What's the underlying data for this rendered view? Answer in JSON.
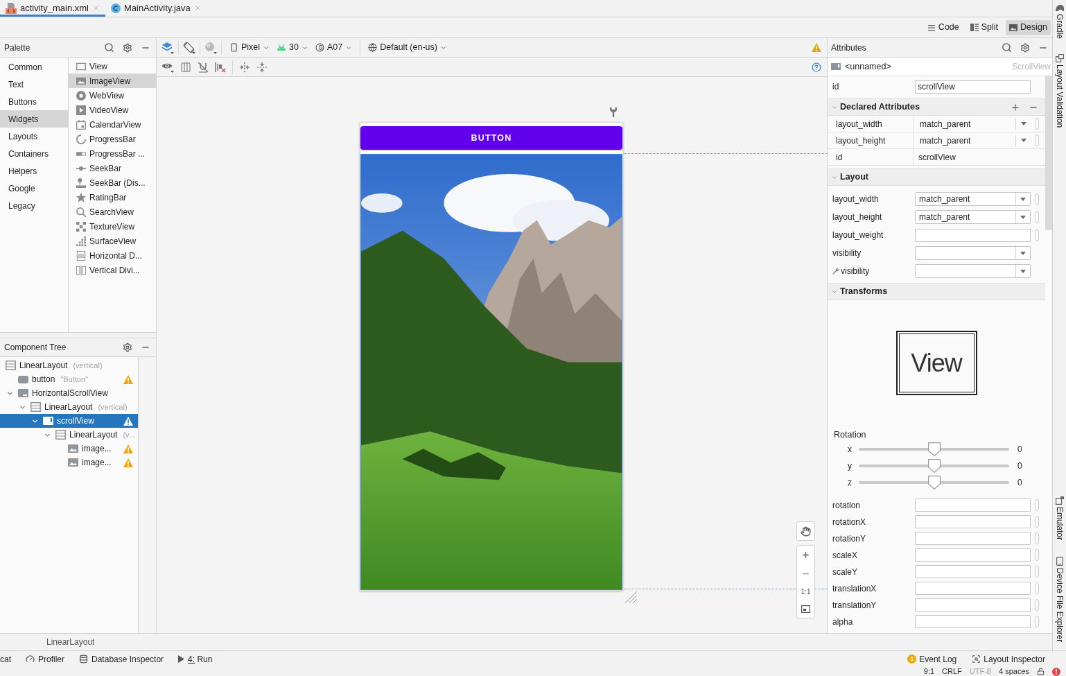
{
  "editor_tabs": [
    {
      "label": "activity_main.xml",
      "kind": "xml",
      "selected": true
    },
    {
      "label": "MainActivity.java",
      "kind": "java",
      "selected": false
    }
  ],
  "view_modes": [
    {
      "label": "Code",
      "selected": false
    },
    {
      "label": "Split",
      "selected": false
    },
    {
      "label": "Design",
      "selected": true
    }
  ],
  "palette": {
    "title": "Palette",
    "categories": [
      {
        "label": "Common",
        "selected": false
      },
      {
        "label": "Text",
        "selected": false
      },
      {
        "label": "Buttons",
        "selected": false
      },
      {
        "label": "Widgets",
        "selected": true
      },
      {
        "label": "Layouts",
        "selected": false
      },
      {
        "label": "Containers",
        "selected": false
      },
      {
        "label": "Helpers",
        "selected": false
      },
      {
        "label": "Google",
        "selected": false
      },
      {
        "label": "Legacy",
        "selected": false
      }
    ],
    "items": [
      {
        "label": "View",
        "selected": false
      },
      {
        "label": "ImageView",
        "selected": true
      },
      {
        "label": "WebView",
        "selected": false
      },
      {
        "label": "VideoView",
        "selected": false
      },
      {
        "label": "CalendarView",
        "selected": false
      },
      {
        "label": "ProgressBar",
        "selected": false
      },
      {
        "label": "ProgressBar ...",
        "selected": false
      },
      {
        "label": "SeekBar",
        "selected": false
      },
      {
        "label": "SeekBar (Dis...",
        "selected": false
      },
      {
        "label": "RatingBar",
        "selected": false
      },
      {
        "label": "SearchView",
        "selected": false
      },
      {
        "label": "TextureView",
        "selected": false
      },
      {
        "label": "SurfaceView",
        "selected": false
      },
      {
        "label": "Horizontal D...",
        "selected": false
      },
      {
        "label": "Vertical Divi...",
        "selected": false
      }
    ]
  },
  "component_tree": {
    "title": "Component Tree",
    "nodes": [
      {
        "kind": "linear_layout",
        "label": "LinearLayout",
        "hint": "(vertical)",
        "warning": false,
        "selected": false,
        "children": [
          {
            "kind": "button",
            "label": "button",
            "hint": "\"Button\"",
            "warning": true,
            "selected": false
          },
          {
            "kind": "horizontal_scroll_view",
            "label": "HorizontalScrollView",
            "warning": false,
            "selected": false,
            "expanded": true,
            "children": [
              {
                "kind": "linear_layout",
                "label": "LinearLayout",
                "hint": "(vertical)",
                "warning": false,
                "selected": false,
                "expanded": true,
                "children": [
                  {
                    "kind": "scroll_view",
                    "label": "scrollView",
                    "warning": true,
                    "selected": true,
                    "expanded": true,
                    "children": [
                      {
                        "kind": "linear_layout",
                        "label": "LinearLayout",
                        "hint": "(v...",
                        "warning": false,
                        "selected": false,
                        "expanded": true,
                        "children": [
                          {
                            "kind": "image_view",
                            "label": "image...",
                            "warning": true,
                            "selected": false
                          },
                          {
                            "kind": "image_view",
                            "label": "image...",
                            "warning": true,
                            "selected": false
                          }
                        ]
                      }
                    ]
                  }
                ]
              }
            ]
          }
        ]
      }
    ]
  },
  "design_toolbar": {
    "dropdowns": [
      {
        "kind": "device",
        "label": "Pixel"
      },
      {
        "kind": "api",
        "label": "30"
      },
      {
        "kind": "theme",
        "label": "A07"
      },
      {
        "kind": "locale",
        "label": "Default (en-us)"
      }
    ]
  },
  "preview": {
    "button_label": "BUTTON",
    "zoom_actual_size": "1:1"
  },
  "attributes": {
    "title": "Attributes",
    "component": {
      "name": "<unnamed>",
      "type": "ScrollView"
    },
    "id_field": {
      "label": "id",
      "value": "scrollView"
    },
    "sections": [
      {
        "kind": "table",
        "title": "Declared Attributes",
        "expanded": true,
        "rows": [
          {
            "label": "layout_width",
            "value": "match_parent",
            "kind": "dropdown",
            "picker": true
          },
          {
            "label": "layout_height",
            "value": "match_parent",
            "kind": "dropdown",
            "picker": true
          },
          {
            "label": "id",
            "value": "scrollView",
            "kind": "text",
            "picker": false
          }
        ]
      },
      {
        "kind": "form",
        "title": "Layout",
        "expanded": true,
        "rows": [
          {
            "label": "layout_width",
            "value": "match_parent",
            "kind": "dropdown",
            "picker": true,
            "tool_attribute": false
          },
          {
            "label": "layout_height",
            "value": "match_parent",
            "kind": "dropdown",
            "picker": true,
            "tool_attribute": false
          },
          {
            "label": "layout_weight",
            "kind": "field",
            "picker": true,
            "tool_attribute": false
          },
          {
            "label": "visibility",
            "kind": "dropdown",
            "picker": false,
            "tool_attribute": false
          },
          {
            "label": "visibility",
            "kind": "dropdown",
            "picker": false,
            "tool_attribute": true
          }
        ]
      },
      {
        "kind": "transforms",
        "title": "Transforms",
        "expanded": true,
        "preview_label": "View",
        "rotation": {
          "label": "Rotation",
          "axes": [
            {
              "axis": "x",
              "level": 0.5,
              "reading": "0"
            },
            {
              "axis": "y",
              "level": 0.5,
              "reading": "0"
            },
            {
              "axis": "z",
              "level": 0.5,
              "reading": "0"
            }
          ]
        },
        "rows": [
          {
            "label": "rotation",
            "kind": "field",
            "picker": true
          },
          {
            "label": "rotationX",
            "kind": "field",
            "picker": true
          },
          {
            "label": "rotationY",
            "kind": "field",
            "picker": true
          },
          {
            "label": "scaleX",
            "kind": "field",
            "picker": true
          },
          {
            "label": "scaleY",
            "kind": "field",
            "picker": true
          },
          {
            "label": "translationX",
            "kind": "field",
            "picker": true
          },
          {
            "label": "translationY",
            "kind": "field",
            "picker": true
          },
          {
            "label": "alpha",
            "kind": "field",
            "picker": true
          }
        ]
      }
    ]
  },
  "breadcrumb": [
    "LinearLayout"
  ],
  "tool_windows": {
    "left": [
      {
        "label": "cat"
      },
      {
        "label": "Profiler"
      },
      {
        "label": "Database Inspector"
      },
      {
        "label": "4: Run"
      }
    ],
    "right": [
      {
        "label": "Event Log",
        "badge": "1"
      },
      {
        "label": "Layout Inspector"
      }
    ]
  },
  "status_bar": [
    {
      "text": "9:1",
      "disabled": false
    },
    {
      "text": "CRLF",
      "disabled": false
    },
    {
      "text": "UTF-8",
      "disabled": true
    },
    {
      "text": "4 spaces",
      "disabled": false
    }
  ],
  "side_tool_windows": {
    "top": [
      "Gradle",
      "Layout Validation"
    ],
    "bottom": [
      "Emulator",
      "Device File Explorer"
    ]
  }
}
